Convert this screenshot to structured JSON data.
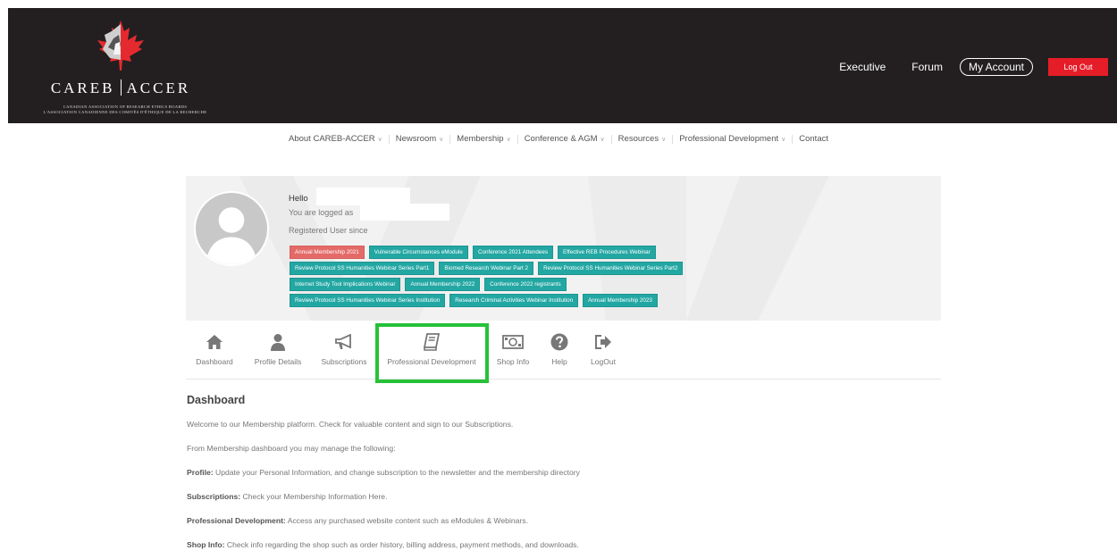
{
  "brand": {
    "name_left": "CAREB",
    "name_right": "ACCER",
    "subtitle_en": "CANADIAN ASSOCIATION OF RESEARCH ETHICS BOARDS",
    "subtitle_fr": "L'ASSOCIATION CANADIENNE DES COMITÉS D'ÉTHIQUE DE LA RECHERCHE"
  },
  "topnav": {
    "executive": "Executive",
    "forum": "Forum",
    "my_account": "My Account",
    "logout": "Log Out"
  },
  "mainmenu": {
    "items": [
      {
        "label": "About CAREB-ACCER",
        "dropdown": true
      },
      {
        "label": "Newsroom",
        "dropdown": true
      },
      {
        "label": "Membership",
        "dropdown": true
      },
      {
        "label": "Conference & AGM",
        "dropdown": true
      },
      {
        "label": "Resources",
        "dropdown": true
      },
      {
        "label": "Professional Development",
        "dropdown": true
      },
      {
        "label": "Contact",
        "dropdown": false
      }
    ]
  },
  "profile": {
    "hello": "Hello",
    "logged_as": "You are logged as",
    "registered_since": "Registered User since",
    "badges": [
      [
        "Annual Membership 2021",
        "Vulnerable Circumstances eModule",
        "Conference 2021 Attendees",
        "Effective REB Procedures Webinar"
      ],
      [
        "Review Protocol SS Humanities Webinar Series Part1",
        "Biomed Research Webinar Part 2",
        "Review Protocol SS Humanities Webinar Series Part2"
      ],
      [
        "Internet Study Tool Implications Webinar",
        "Annual Membership 2022",
        "Conference 2022 registrants"
      ],
      [
        "Review Protocol SS Humanities Webinar Series Institution",
        "Research Criminal Activities Webinar Institution",
        "Annual Membership 2023"
      ]
    ],
    "badge_colors": {
      "default": "#23a7a3",
      "highlight": "#e46a67"
    }
  },
  "tabs": {
    "dashboard": "Dashboard",
    "profile_details": "Profile Details",
    "subscriptions": "Subscriptions",
    "professional_development": "Professional Development",
    "shop_info": "Shop Info",
    "help": "Help",
    "logout": "LogOut"
  },
  "content": {
    "title": "Dashboard",
    "welcome": "Welcome to our Membership platform. Check for valuable content and sign to our Subscriptions.",
    "manage": "From Membership dashboard you may manage the following:",
    "items": [
      {
        "term": "Profile:",
        "text": " Update your Personal Information, and change subscription to the newsletter and the membership directory"
      },
      {
        "term": "Subscriptions:",
        "text": " Check your Membership Information Here."
      },
      {
        "term": "Professional Development:",
        "text": " Access any purchased website content such as eModules & Webinars."
      },
      {
        "term": "Shop Info:",
        "text": " Check info regarding the shop such as order history, billing address, payment methods, and downloads."
      }
    ]
  },
  "colors": {
    "header_bg": "#231f20",
    "logout_red": "#e51d28",
    "teal": "#23a7a3",
    "highlight_green": "#26c139"
  }
}
